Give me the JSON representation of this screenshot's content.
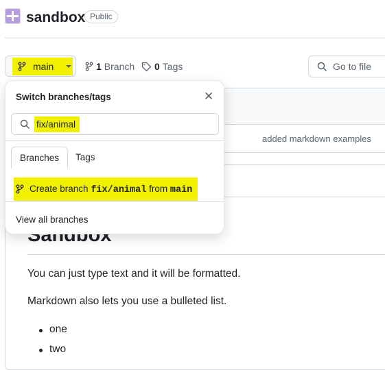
{
  "repo": {
    "name": "sandbox",
    "visibility": "Public"
  },
  "toolbar": {
    "branch": "main",
    "branch_count": "1",
    "branch_label": "Branch",
    "tag_count": "0",
    "tag_label": "Tags",
    "goto_file": "Go to file"
  },
  "files": {
    "latest_commit": "added markdown examples"
  },
  "readme": {
    "heading": "Sandbox",
    "p1": "You can just type text and it will be formatted.",
    "p2": "Markdown also lets you use a bulleted list.",
    "list": [
      "one",
      "two"
    ]
  },
  "popover": {
    "title": "Switch branches/tags",
    "filter_value": "fix/animal",
    "tabs": [
      "Branches",
      "Tags"
    ],
    "create_prefix": "Create branch",
    "create_name": "fix/animal",
    "create_mid": "from",
    "create_source": "main",
    "view_all": "View all branches"
  },
  "colors": {
    "highlight": "#f0f000",
    "accent": "#b79ddd"
  }
}
